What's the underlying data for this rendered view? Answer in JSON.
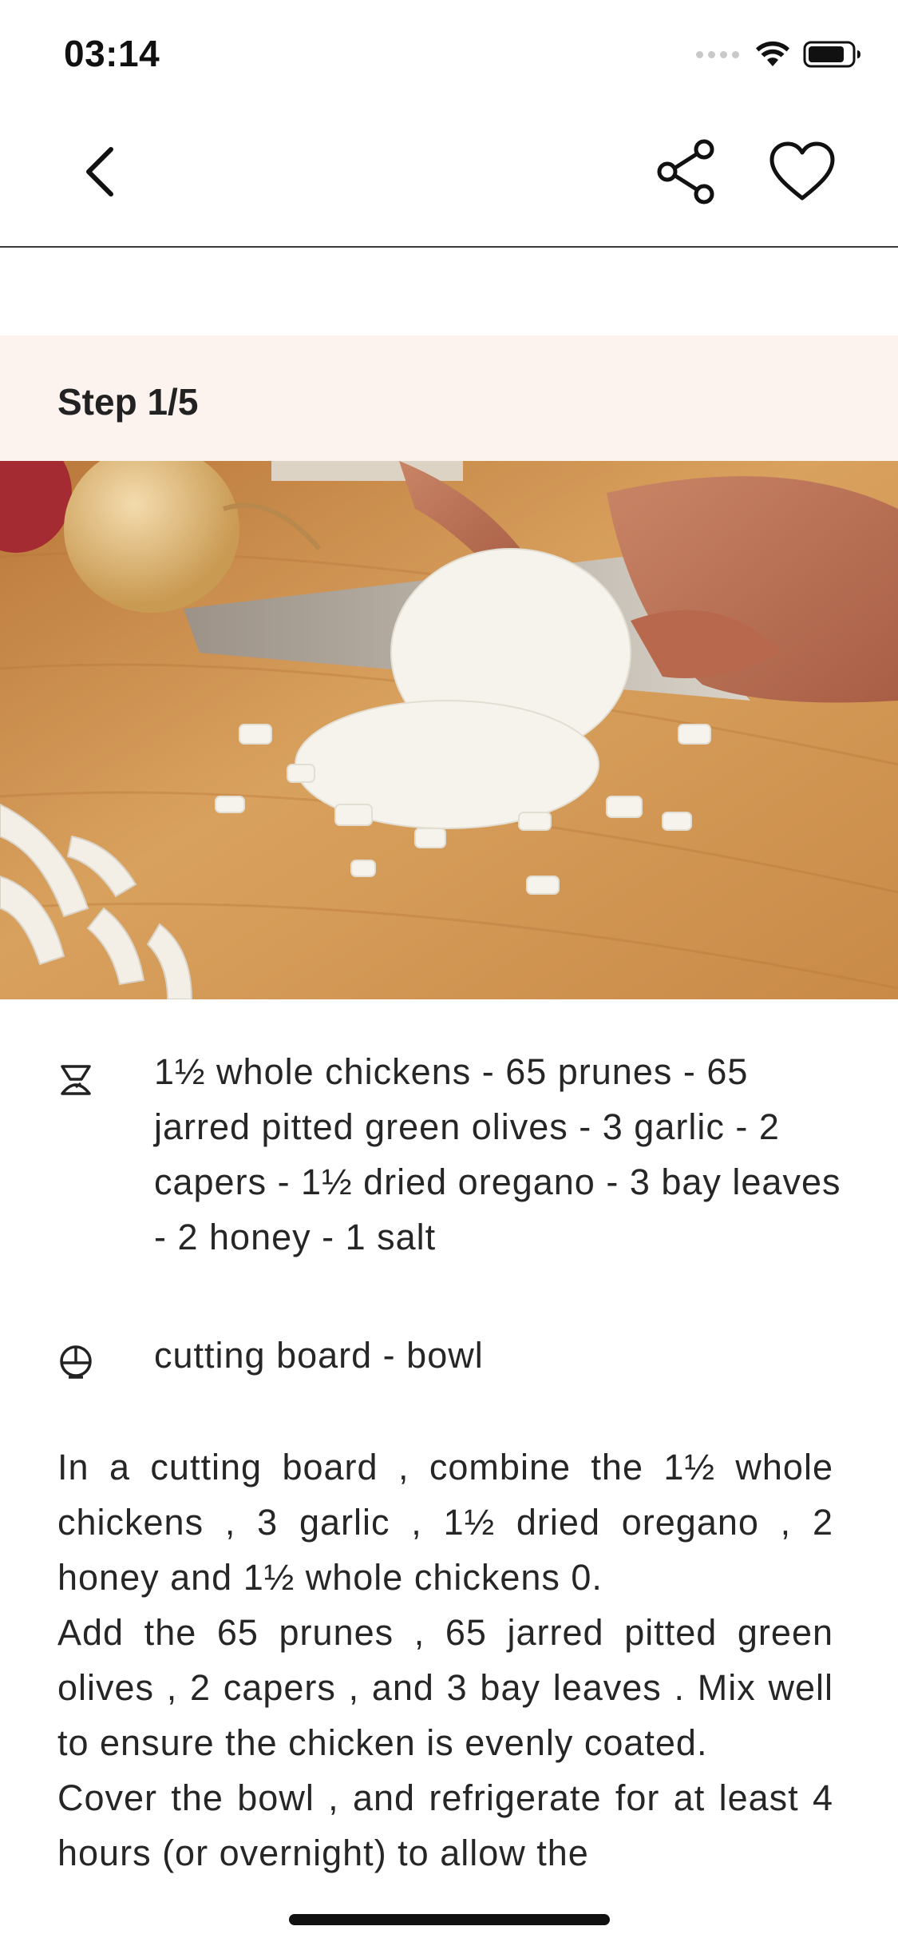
{
  "status_bar": {
    "time": "03:14"
  },
  "nav": {
    "back_icon": "chevron-left-icon",
    "share_icon": "share-icon",
    "favorite_icon": "heart-outline-icon"
  },
  "step": {
    "label": "Step 1/5"
  },
  "ingredients": {
    "icon": "scale-icon",
    "text": "1½ whole chickens - 65 prunes - 65 jarred pitted green olives - 3 garlic - 2 capers - 1½ dried oregano - 3 bay leaves - 2 honey - 1 salt"
  },
  "equipment": {
    "icon": "cookware-icon",
    "text": "cutting board - bowl"
  },
  "instructions": [
    "In a cutting board , combine the 1½ whole chickens , 3 garlic , 1½ dried oregano , 2 honey and 1½ whole chickens 0.",
    "Add the 65 prunes , 65 jarred pitted green olives , 2 capers , and 3 bay leaves . Mix well to ensure the chicken is evenly coated.",
    "Cover the bowl , and refrigerate for at least 4 hours (or overnight) to allow the"
  ]
}
